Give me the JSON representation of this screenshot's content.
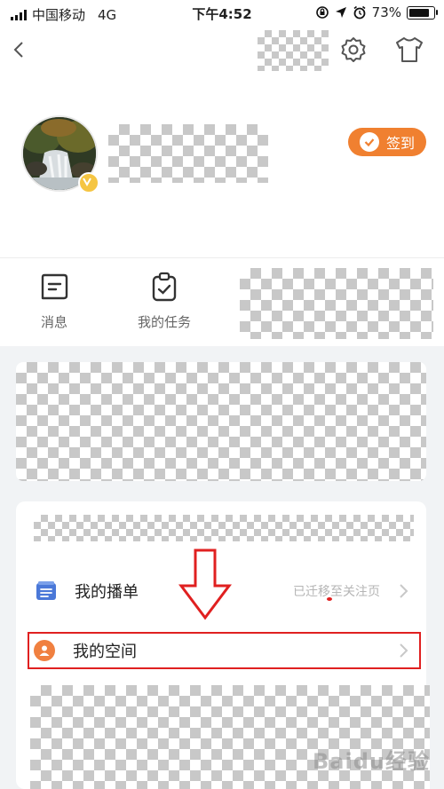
{
  "status_bar": {
    "carrier": "中国移动",
    "network": "4G",
    "time": "下午4:52",
    "battery": "73%"
  },
  "header": {
    "icons": [
      "back-icon",
      "settings-gear-icon",
      "shirt-icon"
    ]
  },
  "profile": {
    "signin_label": "签到"
  },
  "quick_actions": [
    {
      "label": "消息",
      "icon": "message-icon"
    },
    {
      "label": "我的任务",
      "icon": "task-clipboard-icon"
    }
  ],
  "menu": {
    "playlist": {
      "label": "我的播单",
      "sub": "已迁移至关注页"
    },
    "space": {
      "label": "我的空间"
    }
  },
  "watermark": "Baidu经验",
  "colors": {
    "accent": "#f08030",
    "playlist_icon": "#4a78d8",
    "highlight": "#e02020",
    "background_grey": "#f1f3f5"
  }
}
